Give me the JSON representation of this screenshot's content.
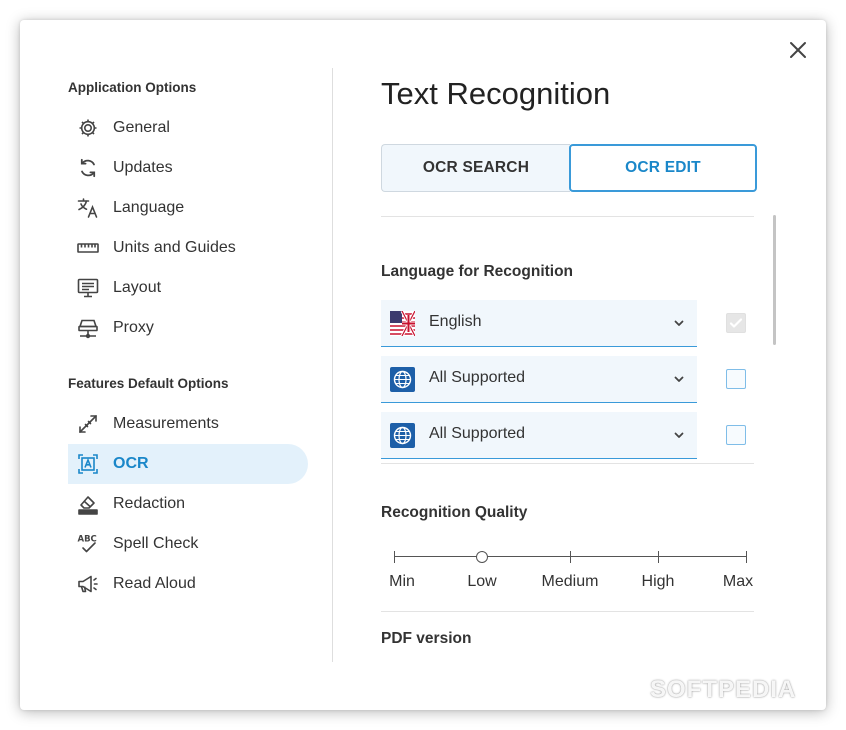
{
  "dialog": {
    "close_icon": "close-icon"
  },
  "sidebar": {
    "sections": [
      {
        "title": "Application Options",
        "items": [
          {
            "label": "General",
            "icon": "gear-icon"
          },
          {
            "label": "Updates",
            "icon": "refresh-icon"
          },
          {
            "label": "Language",
            "icon": "translate-icon"
          },
          {
            "label": "Units and Guides",
            "icon": "ruler-icon"
          },
          {
            "label": "Layout",
            "icon": "monitor-icon"
          },
          {
            "label": "Proxy",
            "icon": "network-icon"
          }
        ]
      },
      {
        "title": "Features Default Options",
        "items": [
          {
            "label": "Measurements",
            "icon": "measure-icon"
          },
          {
            "label": "OCR",
            "icon": "ocr-icon",
            "active": true
          },
          {
            "label": "Redaction",
            "icon": "eraser-icon"
          },
          {
            "label": "Spell Check",
            "icon": "spellcheck-icon"
          },
          {
            "label": "Read Aloud",
            "icon": "megaphone-icon"
          }
        ]
      }
    ]
  },
  "main": {
    "title": "Text Recognition",
    "tabs": [
      {
        "label": "OCR SEARCH",
        "selected": false
      },
      {
        "label": "OCR EDIT",
        "selected": true
      }
    ],
    "language_section": {
      "title": "Language for Recognition",
      "rows": [
        {
          "value": "English",
          "icon": "uk-flag-icon",
          "checked": true,
          "disabled": true
        },
        {
          "value": "All Supported",
          "icon": "globe-icon",
          "checked": false
        },
        {
          "value": "All Supported",
          "icon": "globe-icon",
          "checked": false
        }
      ]
    },
    "quality_section": {
      "title": "Recognition Quality",
      "levels": [
        "Min",
        "Low",
        "Medium",
        "High",
        "Max"
      ],
      "selected_index": 1
    },
    "pdf_section": {
      "title": "PDF version"
    }
  },
  "colors": {
    "accent": "#1a87c9",
    "active_bg": "#e3f1fb",
    "field_bg": "#f1f7fc"
  },
  "watermark": "SOFTPEDIA"
}
